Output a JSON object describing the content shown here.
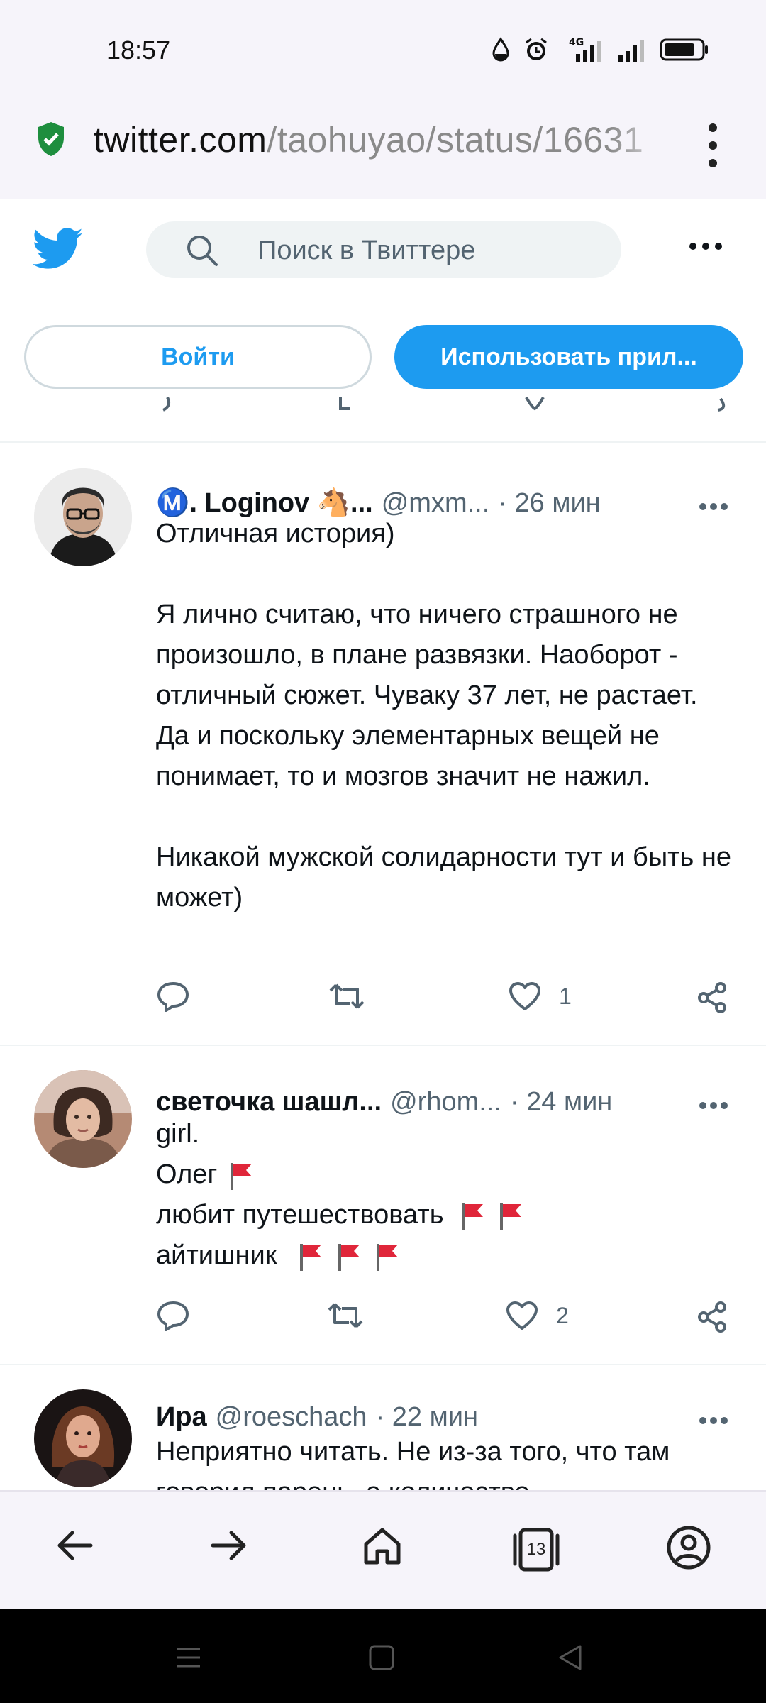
{
  "status_bar": {
    "time": "18:57",
    "network": "4G"
  },
  "browser": {
    "url_host": "twitter.com",
    "url_path": "/taohuyao/status/16631",
    "tab_count": "13"
  },
  "twitter": {
    "search_placeholder": "Поиск в Твиттере",
    "login_label": "Войти",
    "app_label": "Использовать прил..."
  },
  "tweets": [
    {
      "name": "Ⓜ️. Loginov 🐴...",
      "handle": "@mxm...",
      "time": "· 26 мин",
      "body": "Отличная история)\n\nЯ лично считаю, что ничего страшного не произошло, в плане развязки. Наоборот - отличный сюжет. Чуваку 37 лет, не растает. Да и поскольку элементарных вещей не понимает, то и мозгов значит не нажил.\n\nНикакой мужской солидарности тут и быть не может)",
      "likes": "1"
    },
    {
      "name": "светочка шашл...",
      "handle": "@rhom...",
      "time": "· 24 мин",
      "lines": [
        "girl.",
        "Олег",
        "любит путешествовать",
        "айтишник"
      ],
      "likes": "2"
    },
    {
      "name": "Ира",
      "handle": "@roeschach",
      "time": "· 22 мин",
      "body": "Неприятно читать. Не из-за того, что там говорил парень, а количество"
    }
  ],
  "colors": {
    "twitter_blue": "#1d9bf0",
    "text": "#0f1419",
    "muted": "#536471",
    "flag_red": "#e0263a"
  }
}
